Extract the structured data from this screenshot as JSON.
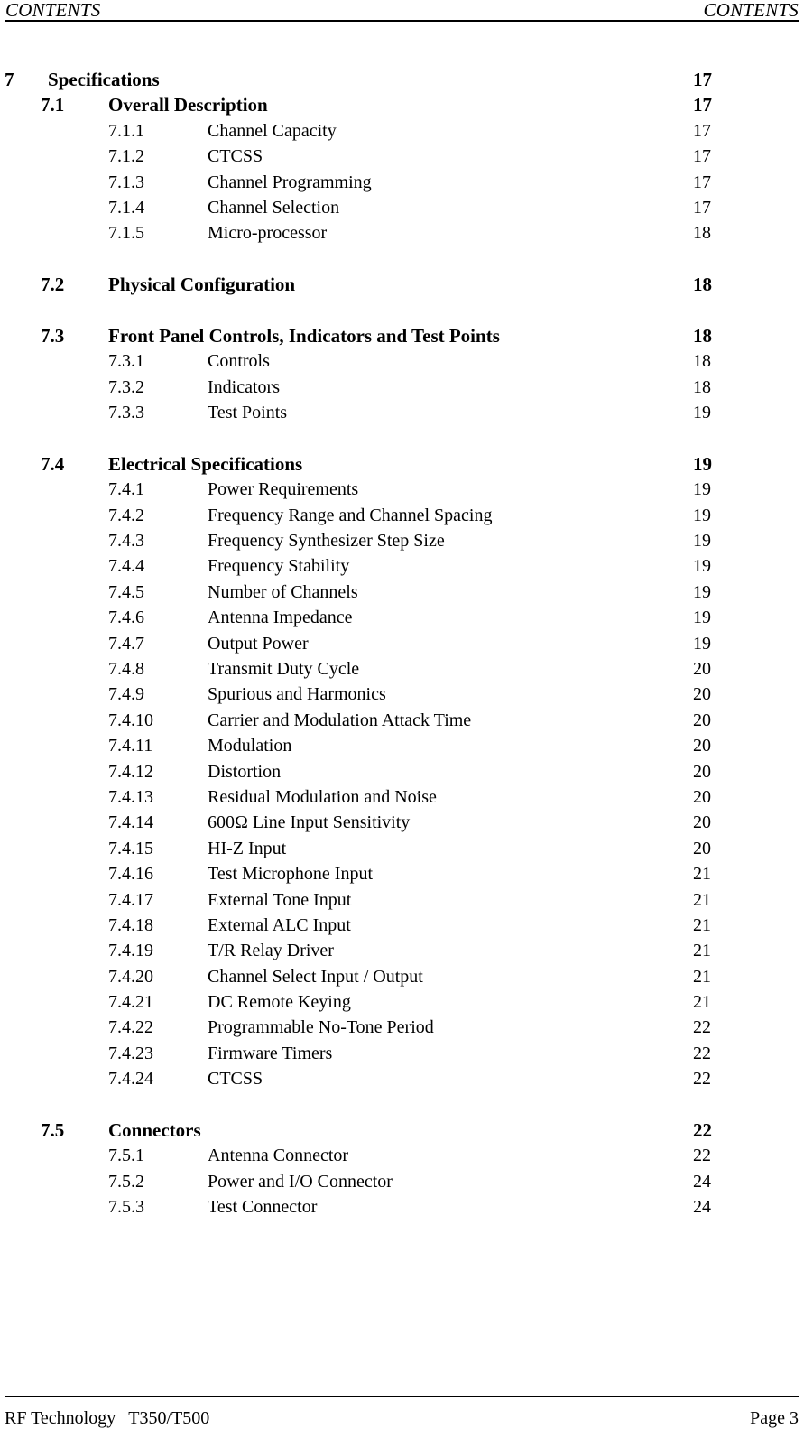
{
  "header": {
    "left": "CONTENTS",
    "right": "CONTENTS"
  },
  "footer": {
    "company": "RF Technology",
    "model": "T350/T500",
    "page_label": "Page 3"
  },
  "toc": {
    "entries": [
      {
        "level": 1,
        "number": "7",
        "title": "Specifications",
        "page": "17",
        "gap_before": false
      },
      {
        "level": 2,
        "number": "7.1",
        "title": "Overall Description",
        "page": "17",
        "gap_before": false
      },
      {
        "level": 3,
        "number": "7.1.1",
        "title": "Channel Capacity",
        "page": "17",
        "gap_before": false
      },
      {
        "level": 3,
        "number": "7.1.2",
        "title": "CTCSS",
        "page": "17",
        "gap_before": false
      },
      {
        "level": 3,
        "number": "7.1.3",
        "title": "Channel Programming",
        "page": "17",
        "gap_before": false
      },
      {
        "level": 3,
        "number": "7.1.4",
        "title": "Channel Selection",
        "page": "17",
        "gap_before": false
      },
      {
        "level": 3,
        "number": "7.1.5",
        "title": "Micro-processor",
        "page": "18",
        "gap_before": false
      },
      {
        "level": 2,
        "number": "7.2",
        "title": "Physical Configuration",
        "page": "18",
        "gap_before": true
      },
      {
        "level": 2,
        "number": "7.3",
        "title": "Front Panel Controls, Indicators and Test Points",
        "page": "18",
        "gap_before": true
      },
      {
        "level": 3,
        "number": "7.3.1",
        "title": "Controls",
        "page": "18",
        "gap_before": false
      },
      {
        "level": 3,
        "number": "7.3.2",
        "title": "Indicators",
        "page": "18",
        "gap_before": false
      },
      {
        "level": 3,
        "number": "7.3.3",
        "title": "Test Points",
        "page": "19",
        "gap_before": false
      },
      {
        "level": 2,
        "number": "7.4",
        "title": "Electrical Specifications",
        "page": "19",
        "gap_before": true
      },
      {
        "level": 3,
        "number": "7.4.1",
        "title": "Power Requirements",
        "page": "19",
        "gap_before": false
      },
      {
        "level": 3,
        "number": "7.4.2",
        "title": "Frequency Range and Channel Spacing",
        "page": "19",
        "gap_before": false
      },
      {
        "level": 3,
        "number": "7.4.3",
        "title": "Frequency Synthesizer Step Size",
        "page": "19",
        "gap_before": false
      },
      {
        "level": 3,
        "number": "7.4.4",
        "title": "Frequency Stability",
        "page": "19",
        "gap_before": false
      },
      {
        "level": 3,
        "number": "7.4.5",
        "title": "Number of Channels",
        "page": "19",
        "gap_before": false
      },
      {
        "level": 3,
        "number": "7.4.6",
        "title": "Antenna Impedance",
        "page": "19",
        "gap_before": false
      },
      {
        "level": 3,
        "number": "7.4.7",
        "title": "Output Power",
        "page": "19",
        "gap_before": false
      },
      {
        "level": 3,
        "number": "7.4.8",
        "title": "Transmit Duty Cycle",
        "page": "20",
        "gap_before": false
      },
      {
        "level": 3,
        "number": "7.4.9",
        "title": "Spurious and Harmonics",
        "page": "20",
        "gap_before": false
      },
      {
        "level": 3,
        "number": "7.4.10",
        "title": "Carrier and Modulation Attack Time",
        "page": "20",
        "gap_before": false
      },
      {
        "level": 3,
        "number": "7.4.11",
        "title": "Modulation",
        "page": "20",
        "gap_before": false
      },
      {
        "level": 3,
        "number": "7.4.12",
        "title": "Distortion",
        "page": "20",
        "gap_before": false
      },
      {
        "level": 3,
        "number": "7.4.13",
        "title": "Residual Modulation and Noise",
        "page": "20",
        "gap_before": false
      },
      {
        "level": 3,
        "number": "7.4.14",
        "title": "600Ω Line Input Sensitivity",
        "page": "20",
        "gap_before": false
      },
      {
        "level": 3,
        "number": "7.4.15",
        "title": "HI-Z Input",
        "page": "20",
        "gap_before": false
      },
      {
        "level": 3,
        "number": "7.4.16",
        "title": "Test Microphone Input",
        "page": "21",
        "gap_before": false
      },
      {
        "level": 3,
        "number": "7.4.17",
        "title": "External Tone Input",
        "page": "21",
        "gap_before": false
      },
      {
        "level": 3,
        "number": "7.4.18",
        "title": "External ALC Input",
        "page": "21",
        "gap_before": false
      },
      {
        "level": 3,
        "number": "7.4.19",
        "title": "T/R Relay Driver",
        "page": "21",
        "gap_before": false
      },
      {
        "level": 3,
        "number": "7.4.20",
        "title": "Channel Select Input / Output",
        "page": "21",
        "gap_before": false
      },
      {
        "level": 3,
        "number": "7.4.21",
        "title": "DC Remote Keying",
        "page": "21",
        "gap_before": false
      },
      {
        "level": 3,
        "number": "7.4.22",
        "title": "Programmable No-Tone Period",
        "page": "22",
        "gap_before": false
      },
      {
        "level": 3,
        "number": "7.4.23",
        "title": "Firmware Timers",
        "page": "22",
        "gap_before": false
      },
      {
        "level": 3,
        "number": "7.4.24",
        "title": "CTCSS",
        "page": "22",
        "gap_before": false
      },
      {
        "level": 2,
        "number": "7.5",
        "title": "Connectors",
        "page": "22",
        "gap_before": true
      },
      {
        "level": 3,
        "number": "7.5.1",
        "title": "Antenna Connector",
        "page": "22",
        "gap_before": false
      },
      {
        "level": 3,
        "number": "7.5.2",
        "title": "Power and I/O Connector",
        "page": "24",
        "gap_before": false
      },
      {
        "level": 3,
        "number": "7.5.3",
        "title": "Test Connector",
        "page": "24",
        "gap_before": false
      }
    ]
  }
}
